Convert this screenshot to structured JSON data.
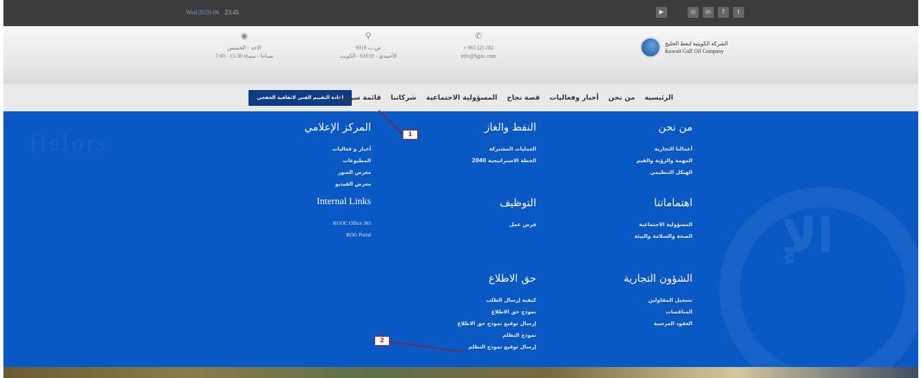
{
  "topbar": {
    "datetime": "Wed 2020-06",
    "time": "23:45",
    "social_icons": [
      "youtube-icon",
      "instagram-icon",
      "linkedin-icon",
      "facebook-icon",
      "twitter-icon"
    ]
  },
  "header": {
    "hours": {
      "icon": "clock-icon",
      "line1": "الاحد - الخميس",
      "line2": "7:00 - 15:30 صباحا - مساء"
    },
    "address": {
      "icon": "location-pin-icon",
      "line1": "ص.ب 9919",
      "line2": "الأحمدي - 61010 - الكويت"
    },
    "contact": {
      "icon": "phone-icon",
      "line1": "+ 965 (2) 182",
      "line2": "info@kgoc.com"
    },
    "logo": {
      "ar": "الشركة الكويتية لنفط الخليج",
      "en": "Kuwait Gulf Oil Company"
    }
  },
  "nav": {
    "items": [
      "الرئيسية",
      "من نحن",
      "أخبار وفعاليات",
      "قصة نجاح",
      "المسؤولية الاجتماعية",
      "شركاتنا",
      "قائمة سريعة"
    ],
    "cta": "إعادة التقييم الفني لاتفاقية الخفجي"
  },
  "mega": {
    "cols": [
      {
        "title": "من نحن",
        "links": [
          "أعمالنا التجارية",
          "المهمة والرؤية والقيم",
          "الهيكل التنظيمي"
        ]
      },
      {
        "title": "النفط والغاز",
        "links": [
          "العمليات المشتركة",
          "الخطة الاستراتيجية 2040"
        ]
      },
      {
        "title": "المركز الإعلامي",
        "links": [
          "أخبار و فعاليات",
          "المطبوعات",
          "معرض الصور",
          "معرض الفيديو"
        ]
      },
      {
        "title": "اهتماماتنا",
        "links": [
          "المسؤولية الاجتماعية",
          "الصحة والسلامة والبيئة"
        ]
      },
      {
        "title": "التوظيف",
        "links": [
          "فرص عمل"
        ]
      },
      {
        "title": "Internal Links",
        "links": [
          "KGOC Office 365",
          "KOG Portal"
        ]
      },
      {
        "title": "الشؤون التجارية",
        "links": [
          "تسجيل المقاولين",
          "المناقصات",
          "العقود المرسية"
        ]
      },
      {
        "title": "حق الاطلاع",
        "links": [
          "كيفية إرسال الطلب",
          "نموذج حق الاطلاع",
          "إرسال توقيع نموذج حق الاطلاع",
          "نموذج التظلم",
          "إرسال توقيع نموذج التظلم"
        ]
      }
    ]
  },
  "callouts": {
    "one": "1",
    "two": "2"
  }
}
